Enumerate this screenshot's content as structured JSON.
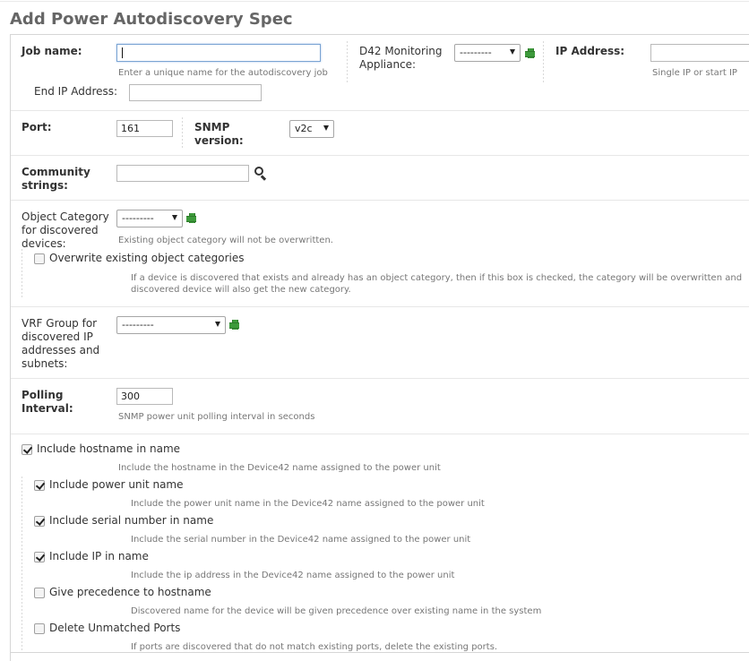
{
  "page": {
    "title": "Add Power Autodiscovery Spec"
  },
  "job": {
    "label": "Job name:",
    "value": "",
    "help": "Enter a unique name for the autodiscovery job"
  },
  "appliance": {
    "label": "D42 Monitoring Appliance:",
    "selected": "---------"
  },
  "ip": {
    "label": "IP Address:",
    "value": "",
    "help": "Single IP or start IP"
  },
  "end_ip": {
    "label": "End IP Address:",
    "value": ""
  },
  "port": {
    "label": "Port:",
    "value": "161"
  },
  "snmp": {
    "label": "SNMP version:",
    "selected": "v2c"
  },
  "community": {
    "label": "Community strings:",
    "value": ""
  },
  "object_category": {
    "label": "Object Category for discovered devices:",
    "selected": "---------",
    "help": "Existing object category will not be overwritten.",
    "overwrite_label": "Overwrite existing object categories",
    "overwrite_checked": false,
    "overwrite_help": "If a device is discovered that exists and already has an object category, then if this box is checked, the category will be overwritten and discovered device will also get the new category."
  },
  "vrf": {
    "label": "VRF Group for discovered IP addresses and subnets:",
    "selected": "---------"
  },
  "polling": {
    "label": "Polling Interval:",
    "value": "300",
    "help": "SNMP power unit polling interval in seconds"
  },
  "options": [
    {
      "label": "Include hostname in name",
      "checked": true,
      "help": "Include the hostname in the Device42 name assigned to the power unit"
    },
    {
      "label": "Include power unit name",
      "checked": true,
      "help": "Include the power unit name in the Device42 name assigned to the power unit"
    },
    {
      "label": "Include serial number in name",
      "checked": true,
      "help": "Include the serial number in the Device42 name assigned to the power unit"
    },
    {
      "label": "Include IP in name",
      "checked": true,
      "help": "Include the ip address in the Device42 name assigned to the power unit"
    },
    {
      "label": "Give precedence to hostname",
      "checked": false,
      "help": "Discovered name for the device will be given precedence over existing name in the system"
    },
    {
      "label": "Delete Unmatched Ports",
      "checked": false,
      "help": "If ports are discovered that do not match existing ports, delete the existing ports."
    }
  ],
  "colors": {
    "title": "#666666",
    "add_icon": "#3d9a3b",
    "focus_border": "#7ba4d3"
  }
}
